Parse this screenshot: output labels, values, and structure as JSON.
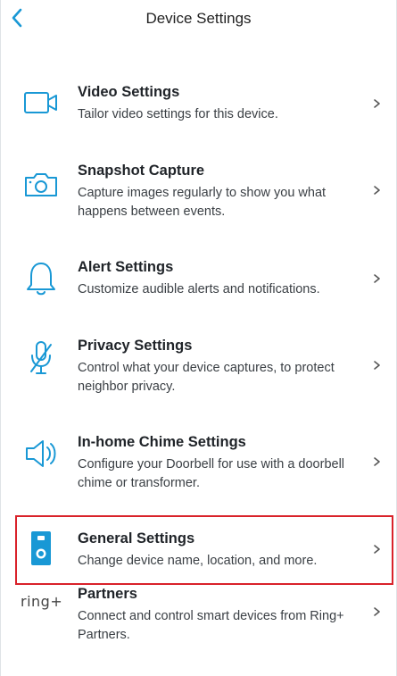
{
  "header": {
    "title": "Device Settings"
  },
  "items": [
    {
      "name": "Video Settings",
      "desc": "Tailor video settings for this device."
    },
    {
      "name": "Snapshot Capture",
      "desc": "Capture images regularly to show you what happens between events."
    },
    {
      "name": "Alert Settings",
      "desc": "Customize audible alerts and notifications."
    },
    {
      "name": "Privacy Settings",
      "desc": "Control what your device captures, to protect neighbor privacy."
    },
    {
      "name": "In-home Chime Settings",
      "desc": "Configure your Doorbell for use with a doorbell chime or transformer."
    },
    {
      "name": "General Settings",
      "desc": "Change device name, location, and more."
    },
    {
      "name": "Partners",
      "desc": "Connect and control smart devices from Ring+ Partners."
    }
  ],
  "partners_logo": "ring+",
  "colors": {
    "accent": "#1998d5",
    "highlight": "#d9222a"
  }
}
